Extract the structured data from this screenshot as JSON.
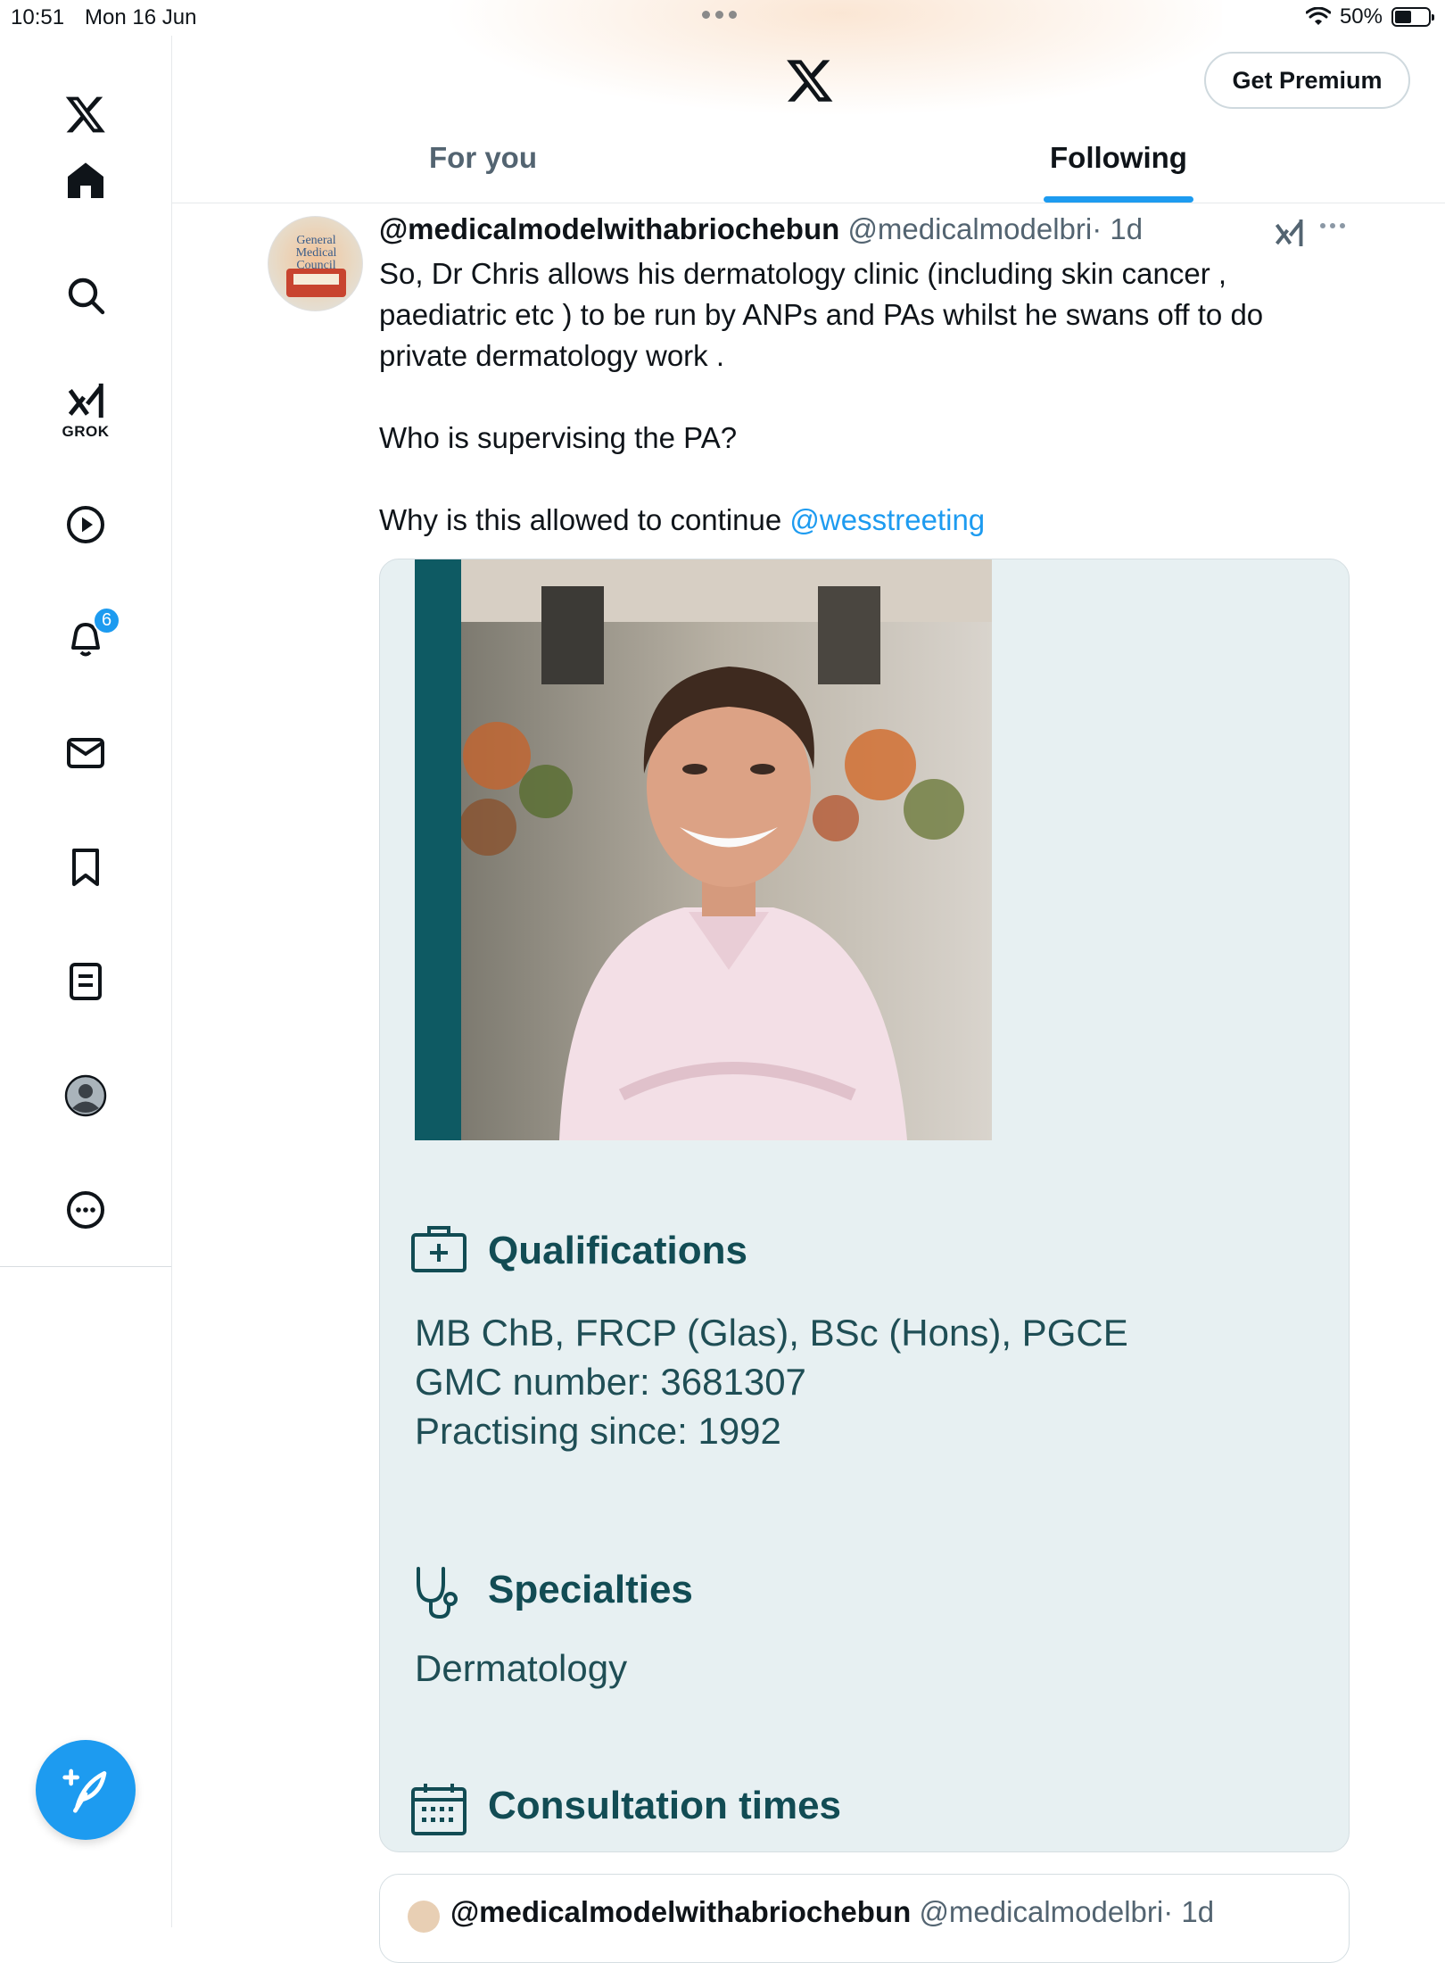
{
  "status_bar": {
    "time": "10:51",
    "date": "Mon 16 Jun",
    "battery": "50%",
    "battery_level": 0.5
  },
  "sidebar": {
    "items": [
      {
        "name": "x-logo",
        "icon": "x-logo-icon"
      },
      {
        "name": "home",
        "icon": "home-icon"
      },
      {
        "name": "search",
        "icon": "search-icon"
      },
      {
        "name": "grok",
        "icon": "grok-icon",
        "label": "GROK"
      },
      {
        "name": "video",
        "icon": "play-icon"
      },
      {
        "name": "notifications",
        "icon": "bell-icon",
        "badge": "6"
      },
      {
        "name": "messages",
        "icon": "mail-icon"
      },
      {
        "name": "bookmarks",
        "icon": "bookmark-icon"
      },
      {
        "name": "lists",
        "icon": "list-icon"
      },
      {
        "name": "profile",
        "icon": "avatar-icon"
      },
      {
        "name": "more",
        "icon": "more-icon"
      }
    ],
    "compose_icon": "compose-icon"
  },
  "header": {
    "premium_label": "Get Premium",
    "tabs": [
      {
        "label": "For you",
        "active": false
      },
      {
        "label": "Following",
        "active": true
      }
    ]
  },
  "tweet": {
    "author": "@medicalmodelwithabriochebun",
    "handle": "@medicalmodelbri",
    "time": "· 1d",
    "text_main": "So, Dr Chris allows his dermatology clinic (including skin cancer , paediatric etc ) to be run by ANPs and PAs whilst he swans off to do private dermatology work .\n\nWho is supervising the PA?\n\nWhy is this allowed to continue ",
    "mention": "@wesstreeting",
    "avatar_text": [
      "General",
      "Medical",
      "Council"
    ],
    "media": {
      "qualifications_heading": "Qualifications",
      "qualifications_lines": [
        "MB ChB, FRCP (Glas), BSc (Hons), PGCE",
        "GMC number: 3681307",
        "Practising since: 1992"
      ],
      "specialties_heading": "Specialties",
      "specialties_value": "Dermatology",
      "consultation_heading": "Consultation times"
    }
  },
  "next_tweet": {
    "author": "@medicalmodelwithabriochebun",
    "handle": "@medicalmodelbri",
    "time": "· 1d"
  },
  "colors": {
    "accent": "#1d9bf0",
    "card_bg": "#e7f0f2",
    "card_heading": "#124c54",
    "card_bar": "#0e5a63"
  }
}
